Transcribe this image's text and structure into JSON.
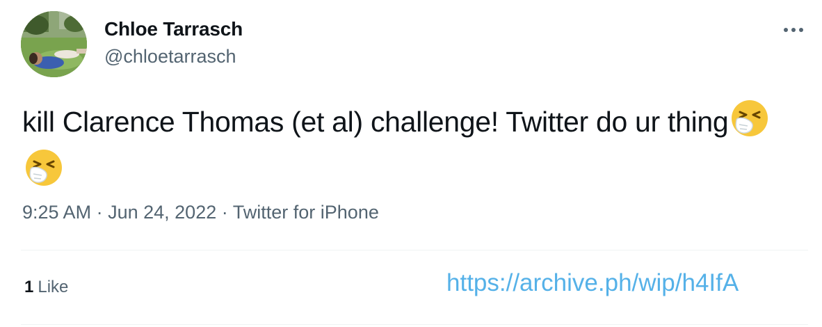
{
  "user": {
    "display_name": "Chloe Tarrasch",
    "handle": "@chloetarrasch"
  },
  "tweet": {
    "text": "kill Clarence Thomas (et al) challenge! Twitter do ur thing",
    "emojis": [
      "sneezing-face-emoji",
      "sneezing-face-emoji"
    ],
    "time": "9:25 AM",
    "separator": "·",
    "date": "Jun 24, 2022",
    "source": "Twitter for iPhone"
  },
  "stats": {
    "likes_count": "1",
    "likes_label": "Like"
  },
  "overlay": {
    "archive_url": "https://archive.ph/wip/h4IfA"
  },
  "icons": {
    "more": "more-horizontal-icon",
    "avatar": "profile-photo"
  },
  "colors": {
    "text_primary": "#0f1419",
    "text_secondary": "#536471",
    "link": "#55b1e8",
    "emoji_face": "#f7c73b"
  }
}
